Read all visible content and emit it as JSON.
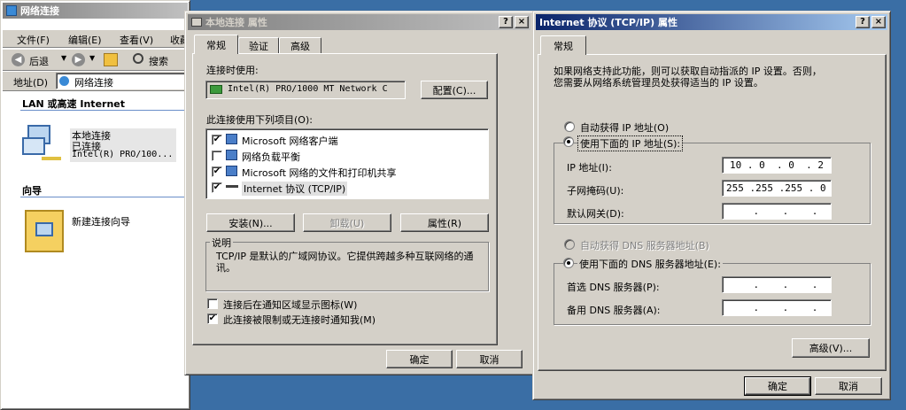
{
  "explorer": {
    "title": "网络连接",
    "menu": [
      "文件(F)",
      "编辑(E)",
      "查看(V)",
      "收藏"
    ],
    "toolbar": {
      "back": "后退",
      "search": "搜索"
    },
    "address_label": "地址(D)",
    "address_value": "网络连接",
    "section_lan": "LAN 或高速 Internet",
    "connection": {
      "name": "本地连接",
      "status": "已连接",
      "device": "Intel(R) PRO/100..."
    },
    "section_wizard": "向导",
    "wizard_label": "新建连接向导"
  },
  "props": {
    "title": "本地连接 属性",
    "tabs": [
      "常规",
      "验证",
      "高级"
    ],
    "connect_using_label": "连接时使用:",
    "adapter_name": "Intel(R) PRO/1000 MT Network C",
    "configure_button": "配置(C)...",
    "items_label": "此连接使用下列项目(O):",
    "items": [
      {
        "label": "Microsoft 网络客户端",
        "checked": "✔"
      },
      {
        "label": "网络负载平衡",
        "checked": ""
      },
      {
        "label": "Microsoft 网络的文件和打印机共享",
        "checked": "✔"
      },
      {
        "label": "Internet 协议 (TCP/IP)",
        "checked": "✔"
      }
    ],
    "install_button": "安装(N)...",
    "uninstall_button": "卸载(U)",
    "properties_button": "属性(R)",
    "description_label": "说明",
    "description_text": "TCP/IP 是默认的广域网协议。它提供跨越多种互联网络的通讯。",
    "show_icon_label": "连接后在通知区域显示图标(W)",
    "show_icon_checked": "",
    "notify_label": "此连接被限制或无连接时通知我(M)",
    "notify_checked": "✔",
    "ok_button": "确定",
    "cancel_button": "取消"
  },
  "tcpip": {
    "title": "Internet 协议 (TCP/IP) 属性",
    "tab": "常规",
    "intro": [
      "如果网络支持此功能，则可以获取自动指派的 IP 设置。否则，",
      "您需要从网络系统管理员处获得适当的 IP 设置。"
    ],
    "auto_ip_label": "自动获得 IP 地址(O)",
    "manual_ip_label": "使用下面的 IP 地址(S):",
    "ip_label": "IP 地址(I):",
    "ip_value": "10 . 0  . 0  . 2",
    "mask_label": "子网掩码(U):",
    "mask_value": "255 .255 .255 . 0",
    "gateway_label": "默认网关(D):",
    "gateway_value": "    .    .    .",
    "auto_dns_label": "自动获得 DNS 服务器地址(B)",
    "manual_dns_label": "使用下面的 DNS 服务器地址(E):",
    "dns1_label": "首选 DNS 服务器(P):",
    "dns1_value": "    .    .    .",
    "dns2_label": "备用 DNS 服务器(A):",
    "dns2_value": "    .    .    .",
    "advanced_button": "高级(V)...",
    "ok_button": "确定",
    "cancel_button": "取消"
  }
}
